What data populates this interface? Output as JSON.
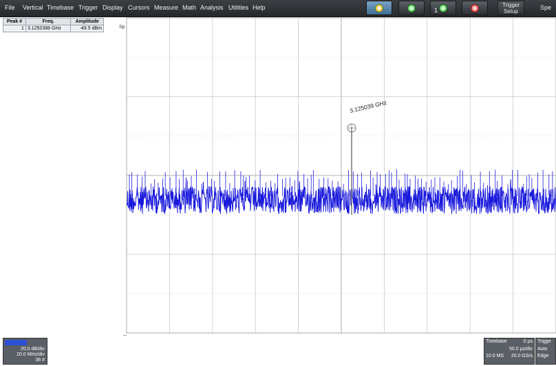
{
  "menu": [
    "File",
    "Vertical",
    "Timebase",
    "Trigger",
    "Display",
    "Cursors",
    "Measure",
    "Math",
    "Analysis",
    "Utilities",
    "Help"
  ],
  "toolbar": {
    "trigger_setup_line1": "Trigger",
    "trigger_setup_line2": "Setup",
    "spe_label": "Spe",
    "channel_number": "1"
  },
  "peak_table": {
    "headers": [
      "Peak #",
      "Freq.",
      "Amplitude"
    ],
    "rows": [
      {
        "num": "1",
        "freq": "3.1250388 GHz",
        "amp": "-49.5 dBm"
      }
    ]
  },
  "plot": {
    "label": "Sp",
    "marker_text": "3.125039 GHz",
    "trace_color": "#1a1adc",
    "grid_color": "#c8c8c8"
  },
  "scale_box": {
    "line1": "20.0 dB/div",
    "line2": "20.0 MHz/div",
    "line3": "38 #"
  },
  "timebase": {
    "title": "Timebase",
    "offset": "0 µs",
    "per_div": "50.0 µs/div",
    "memory": "10.0 MS",
    "rate": "20.0 GS/s"
  },
  "trigger_box": {
    "title": "Trigge",
    "mode": "Auto",
    "type": "Edge"
  }
}
